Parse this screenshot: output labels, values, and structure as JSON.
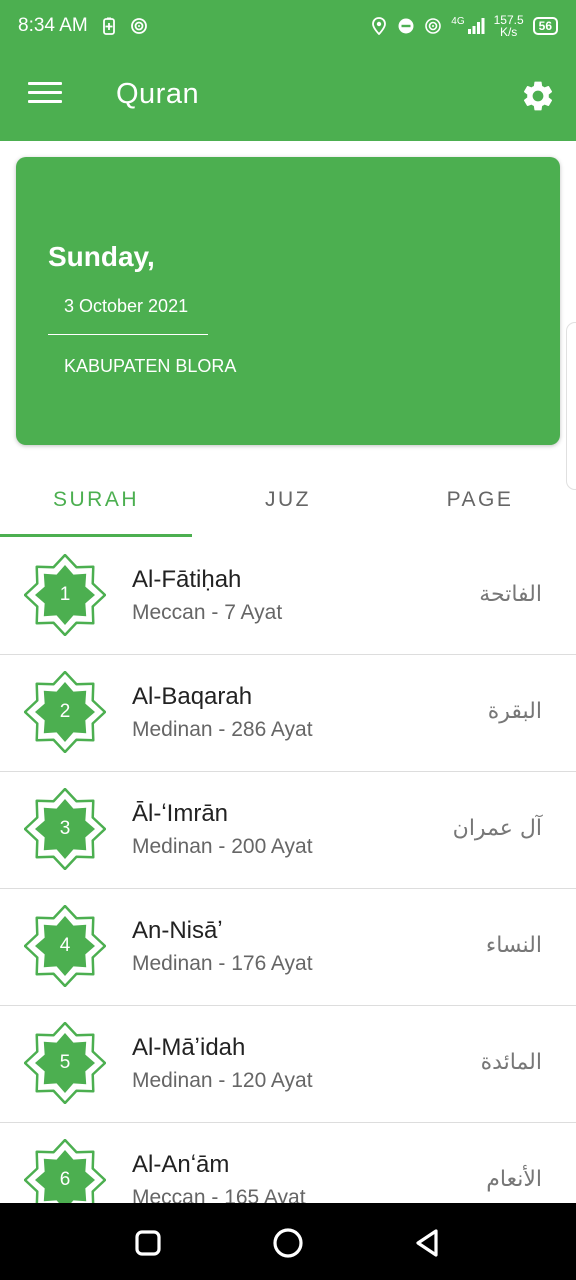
{
  "status_bar": {
    "time": "8:34 AM",
    "network_type": "4G",
    "speed_value": "157.5",
    "speed_unit": "K/s",
    "battery": "56",
    "icons": [
      "battery-saver-icon",
      "hotspot-icon",
      "location-icon",
      "dnd-icon",
      "wifi-calling-icon",
      "signal-icon"
    ]
  },
  "app_bar": {
    "title": "Quran",
    "menu_icon": "hamburger-menu-icon",
    "settings_icon": "gear-icon",
    "color": "#4caf50"
  },
  "date_card": {
    "day": "Sunday,",
    "date": "3 October 2021",
    "location": "KABUPATEN BLORA"
  },
  "tabs": [
    {
      "label": "SURAH",
      "active": true
    },
    {
      "label": "JUZ",
      "active": false
    },
    {
      "label": "PAGE",
      "active": false
    }
  ],
  "surahs": [
    {
      "number": "1",
      "name": "Al-Fātiḥah",
      "subtitle": "Meccan - 7 Ayat",
      "arabic": "الفاتحة"
    },
    {
      "number": "2",
      "name": "Al-Baqarah",
      "subtitle": "Medinan - 286 Ayat",
      "arabic": "البقرة"
    },
    {
      "number": "3",
      "name": "Āl-ʻImrān",
      "subtitle": "Medinan - 200 Ayat",
      "arabic": "آل عمران"
    },
    {
      "number": "4",
      "name": "An-Nisāʼ",
      "subtitle": "Medinan - 176 Ayat",
      "arabic": "النساء"
    },
    {
      "number": "5",
      "name": "Al-Māʼidah",
      "subtitle": "Medinan - 120 Ayat",
      "arabic": "المائدة"
    },
    {
      "number": "6",
      "name": "Al-Anʻām",
      "subtitle": "Meccan - 165 Ayat",
      "arabic": "الأنعام"
    }
  ],
  "nav_bar": {
    "buttons": [
      "recents-square-icon",
      "home-circle-icon",
      "back-triangle-icon"
    ]
  },
  "colors": {
    "accent": "#4caf50",
    "text_primary": "#222222",
    "text_secondary": "#666666",
    "divider": "#dddddd"
  }
}
